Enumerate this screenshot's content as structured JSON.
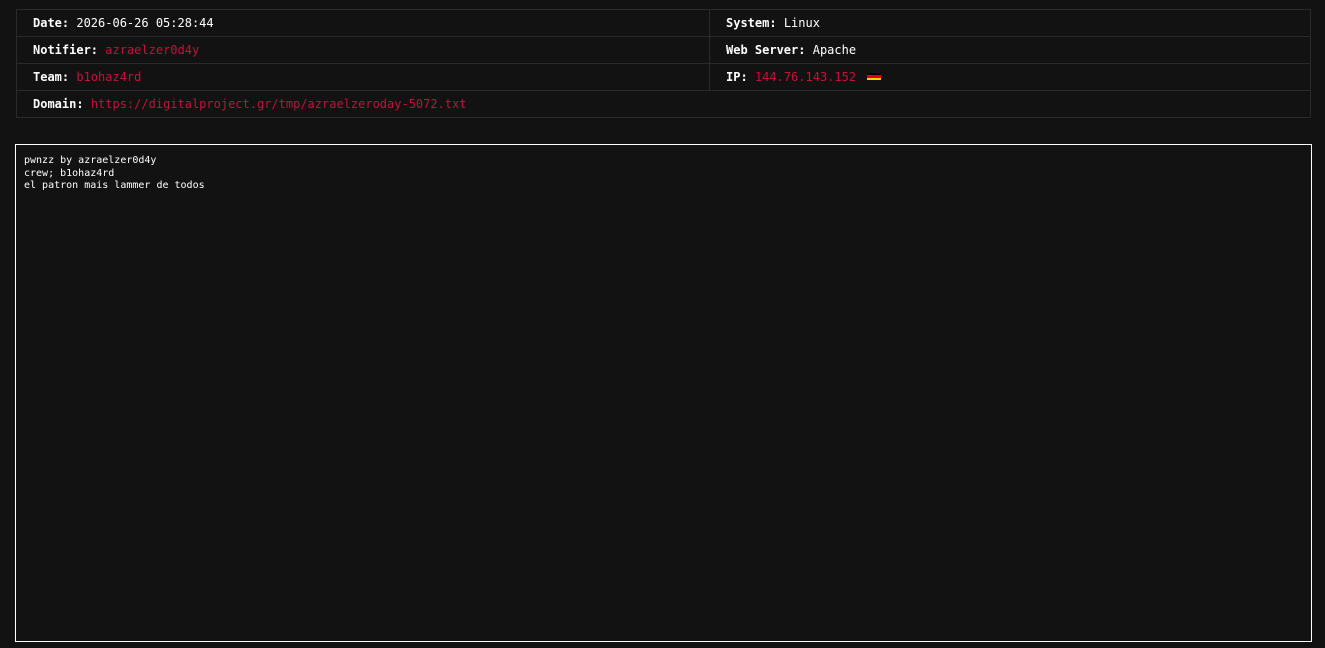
{
  "info": {
    "date": {
      "label": "Date:",
      "value": "2026-06-26 05:28:44"
    },
    "system": {
      "label": "System:",
      "value": "Linux"
    },
    "notifier": {
      "label": "Notifier:",
      "value": "azraelzer0d4y"
    },
    "web_server": {
      "label": "Web Server:",
      "value": "Apache"
    },
    "team": {
      "label": "Team:",
      "value": "b1ohaz4rd"
    },
    "ip": {
      "label": "IP:",
      "value": "144.76.143.152",
      "flag_icon": "germany-flag-icon"
    },
    "domain": {
      "label": "Domain:",
      "value": "https://digitalproject.gr/tmp/azraelzeroday-5072.txt"
    }
  },
  "mirror": {
    "lines": [
      "pwnzz by azraelzer0d4y",
      "crew; b1ohaz4rd",
      "el patron mais lammer de todos"
    ]
  },
  "colors": {
    "background": "#121212",
    "accent_red": "#c0143c",
    "border": "#2a2a2a",
    "frame_border": "#ffffff"
  }
}
